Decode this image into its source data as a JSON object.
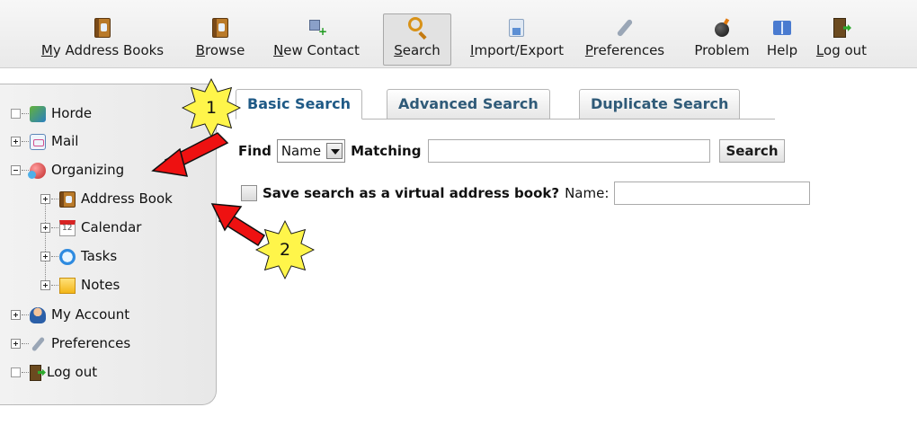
{
  "toolbar": {
    "items": [
      {
        "pre": "",
        "u": "M",
        "post": "y Address Books",
        "icon": "address-book-icon"
      },
      {
        "pre": "",
        "u": "B",
        "post": "rowse",
        "icon": "address-book-icon"
      },
      {
        "pre": "",
        "u": "N",
        "post": "ew Contact",
        "icon": "new-contact-icon"
      },
      {
        "pre": "",
        "u": "S",
        "post": "earch",
        "icon": "search-icon"
      },
      {
        "pre": "",
        "u": "I",
        "post": "mport/Export",
        "icon": "import-export-icon"
      },
      {
        "pre": "",
        "u": "P",
        "post": "references",
        "icon": "wrench-icon"
      },
      {
        "pre": "Problem",
        "u": "",
        "post": "",
        "icon": "bomb-icon"
      },
      {
        "pre": "Help",
        "u": "",
        "post": "",
        "icon": "help-book-icon"
      },
      {
        "pre": "",
        "u": "L",
        "post": "og out",
        "icon": "door-exit-icon"
      }
    ]
  },
  "sidebar": {
    "items": [
      {
        "label": "Horde",
        "icon": "horde-icon"
      },
      {
        "label": "Mail",
        "icon": "mail-icon"
      },
      {
        "label": "Organizing",
        "icon": "organizing-icon"
      },
      {
        "label": "Address Book",
        "icon": "address-book-icon"
      },
      {
        "label": "Calendar",
        "icon": "calendar-icon"
      },
      {
        "label": "Tasks",
        "icon": "tasks-icon"
      },
      {
        "label": "Notes",
        "icon": "notes-icon"
      },
      {
        "label": "My Account",
        "icon": "account-icon"
      },
      {
        "label": "Preferences",
        "icon": "wrench-icon"
      },
      {
        "label": "Log out",
        "icon": "door-exit-icon"
      }
    ]
  },
  "tabs": [
    "Basic Search",
    "Advanced Search",
    "Duplicate Search"
  ],
  "search": {
    "find_label": "Find",
    "field_value": "Name",
    "matching_label": "Matching",
    "query_value": "",
    "button_label": "Search",
    "save_label": "Save search as a virtual address book?",
    "name_label": "Name:",
    "name_value": ""
  },
  "annotations": {
    "marker1": "1",
    "marker2": "2"
  },
  "colors": {
    "accent": "#2f5a78",
    "marker_fill": "#fff54a",
    "arrow": "#ee1111"
  }
}
